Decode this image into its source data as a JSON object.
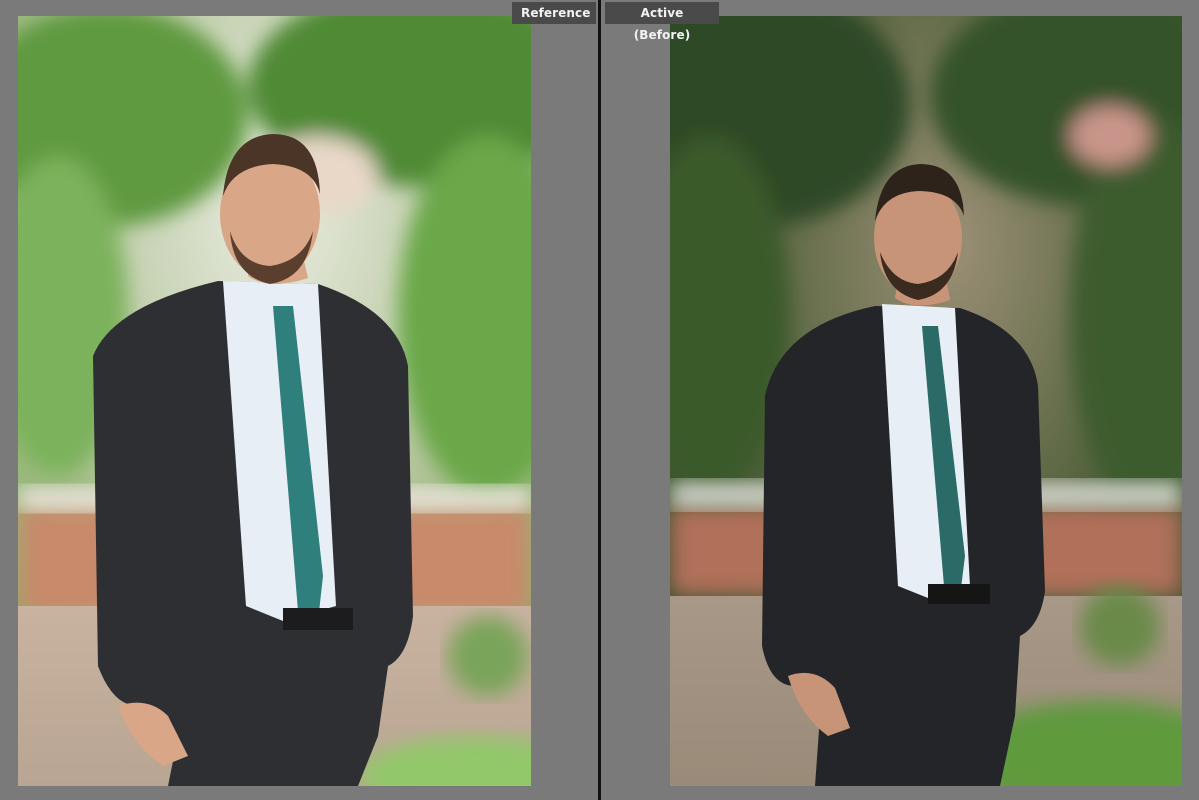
{
  "panels": {
    "reference": {
      "label": "Reference"
    },
    "active": {
      "label": "Active (Before)"
    }
  },
  "colors": {
    "background": "#7a7a7a",
    "label_bg": "#4a4a4a",
    "label_text": "#f2f2f2",
    "divider": "#111111",
    "foliage_light": "#6aa84a",
    "foliage_dark": "#2f4a26",
    "suit": "#2e2f33",
    "tie": "#2f7f7c",
    "shirt": "#e8eef6",
    "skin": "#d9a688"
  },
  "icons": {
    "reference_photo": "portrait-photo-icon",
    "active_photo": "portrait-photo-icon"
  }
}
